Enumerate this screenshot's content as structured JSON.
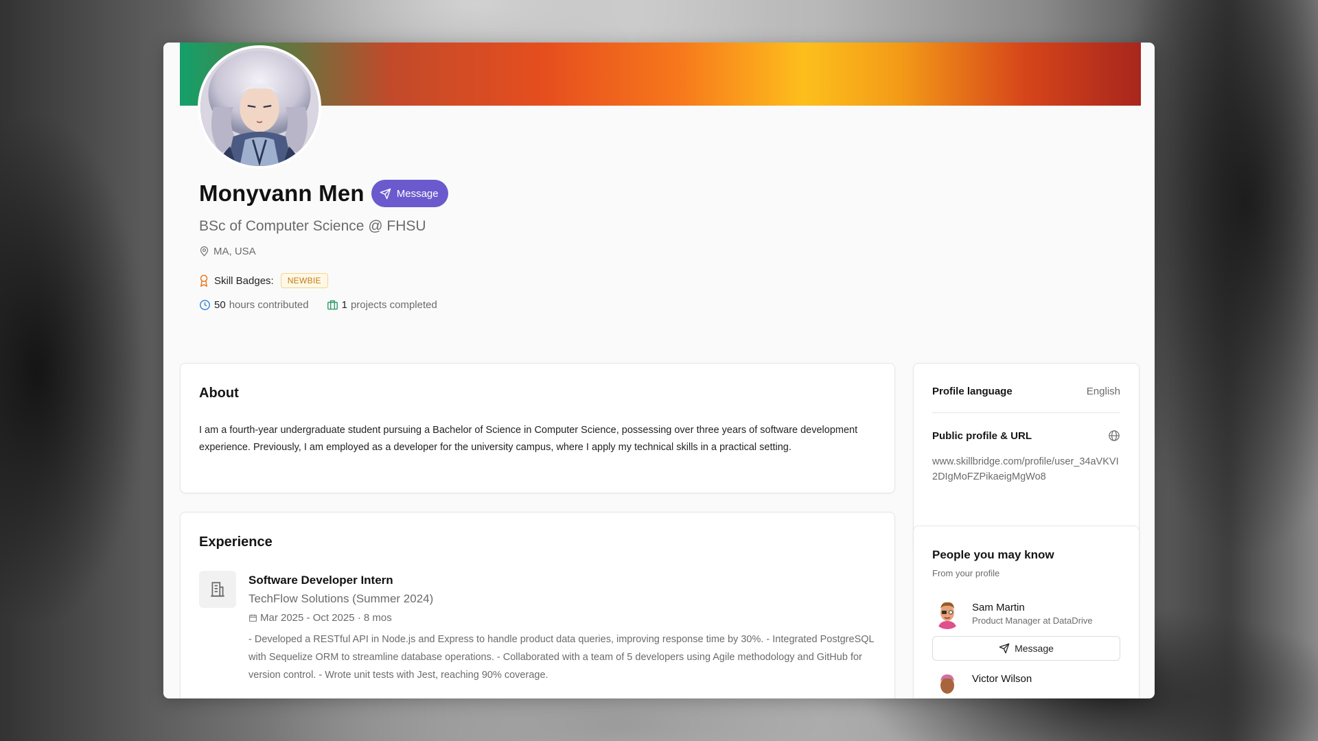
{
  "colors": {
    "accent": "#6a5acd",
    "badge_text": "#c37a12",
    "stat_clock": "#2f80d6",
    "stat_briefcase": "#2e9b6a",
    "badge_icon": "#e8761c"
  },
  "profile": {
    "name": "Monyvann Men",
    "message_label": "Message",
    "headline": "BSc of Computer Science @ FHSU",
    "location": "MA, USA",
    "badges_label": "Skill Badges:",
    "badge": "NEWBIE",
    "hours_value": "50",
    "hours_label": "hours contributed",
    "projects_value": "1",
    "projects_label": "projects completed"
  },
  "about": {
    "title": "About",
    "text": "I am a fourth-year undergraduate student pursuing a Bachelor of Science in Computer Science, possessing over three years of software development experience. Previously, I am employed as a developer for the university campus, where I apply my technical skills in a practical setting."
  },
  "experience": {
    "title": "Experience",
    "items": [
      {
        "title": "Software Developer Intern",
        "company": "TechFlow Solutions (Summer 2024)",
        "dates": "Mar 2025 - Oct 2025 · 8 mos",
        "description": "- Developed a RESTful API in Node.js and Express to handle product data queries, improving response time by 30%. - Integrated PostgreSQL with Sequelize ORM to streamline database operations. - Collaborated with a team of 5 developers using Agile methodology and GitHub for version control. - Wrote unit tests with Jest, reaching 90% coverage."
      }
    ]
  },
  "sidebar": {
    "language_label": "Profile language",
    "language_value": "English",
    "public_label": "Public profile & URL",
    "public_url": "www.skillbridge.com/profile/user_34aVKVI2DIgMoFZPikaeigMgWo8"
  },
  "people": {
    "title": "People you may know",
    "subtitle": "From your profile",
    "items": [
      {
        "name": "Sam Martin",
        "role": "Product Manager at DataDrive",
        "message_label": "Message"
      },
      {
        "name": "Victor Wilson"
      }
    ]
  }
}
